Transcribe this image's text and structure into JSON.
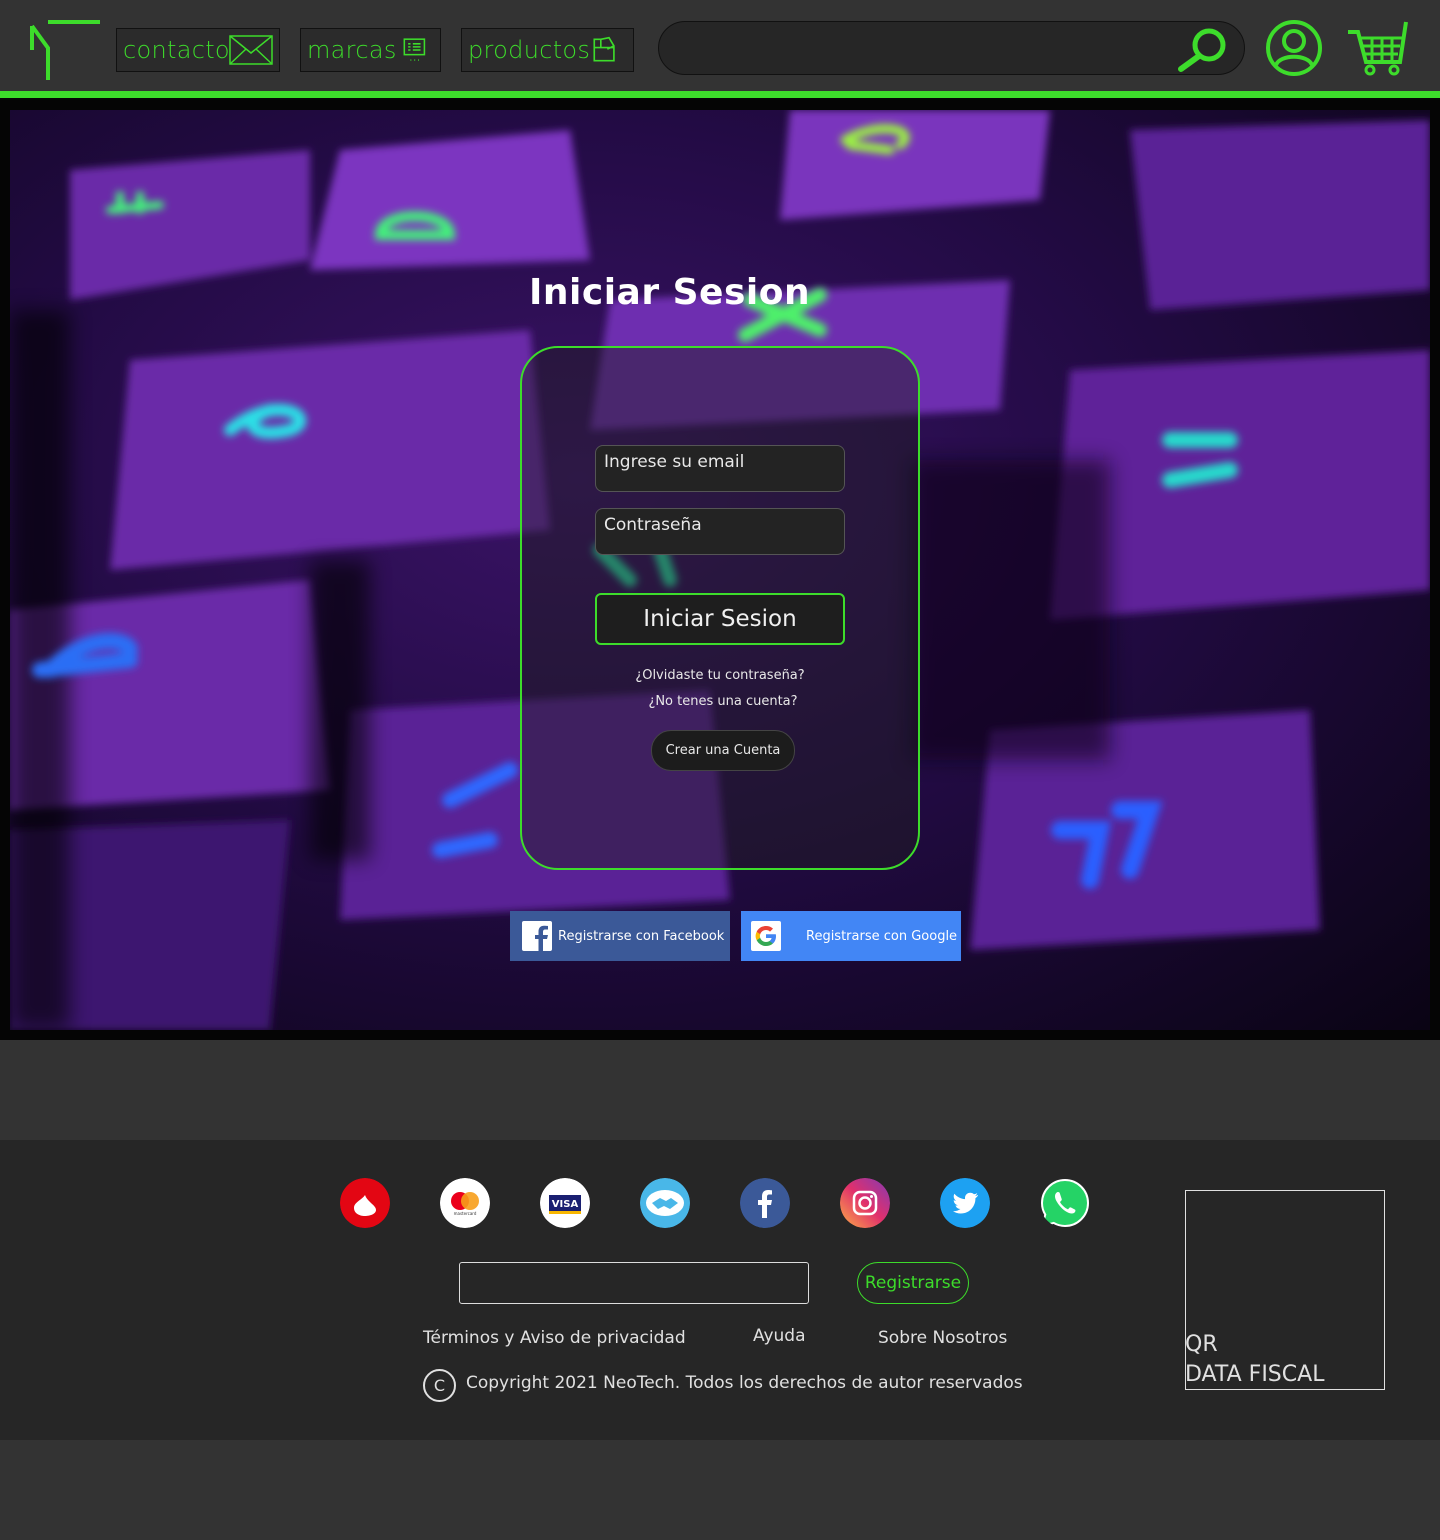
{
  "header": {
    "nav": {
      "contacto": "contacto",
      "marcas": "marcas",
      "productos": "productos"
    },
    "search": {
      "placeholder": ""
    },
    "icons": [
      "logo",
      "envelope-icon",
      "list-icon",
      "box-icon",
      "search-icon",
      "user-icon",
      "cart-icon"
    ],
    "accent": "#3ddc2b"
  },
  "login": {
    "title": "Iniciar Sesion",
    "email_placeholder": "Ingrese su email",
    "password_placeholder": "Contraseña",
    "submit_label": "Iniciar Sesion",
    "forgot_label": "¿Olvidaste tu contraseña?",
    "no_account_label": "¿No tenes una cuenta?",
    "create_label": "Crear una Cuenta"
  },
  "social": {
    "facebook_label": "Registrarse con Facebook",
    "google_label": "Registrarse con Google",
    "facebook_color": "#3b5998",
    "google_color": "#4286f5"
  },
  "footer": {
    "payment_icons": [
      "santander-icon",
      "mastercard-icon",
      "visa-icon",
      "mercadopago-icon",
      "facebook-icon",
      "instagram-icon",
      "twitter-icon",
      "whatsapp-icon"
    ],
    "register_label": "Registrarse",
    "terms_label": "Términos y Aviso de privacidad",
    "help_label": "Ayuda",
    "about_label": "Sobre Nosotros",
    "copyright_symbol": "C",
    "copyright": "Copyright 2021 NeoTech. Todos los derechos de autor reservados",
    "qr_line1": "QR",
    "qr_line2": "DATA FISCAL"
  }
}
